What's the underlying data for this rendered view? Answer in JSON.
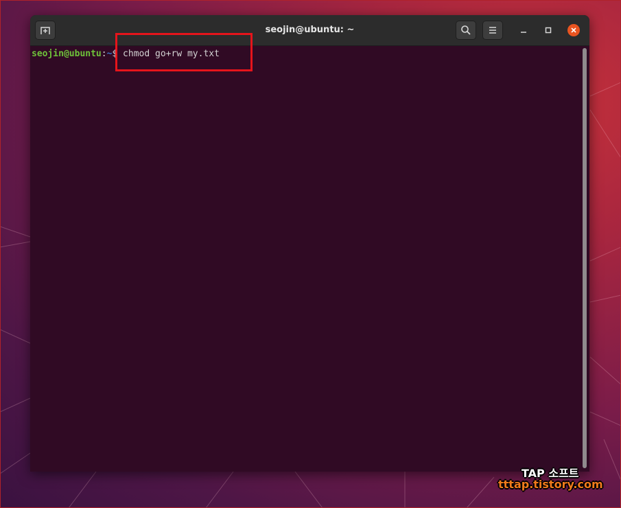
{
  "window": {
    "title": "seojin@ubuntu: ~"
  },
  "terminal": {
    "prompt_user": "seojin@ubuntu",
    "prompt_sep": ":",
    "prompt_path": "~",
    "prompt_symbol": "$",
    "command": " chmod go+rw my.txt"
  },
  "watermark": {
    "title": "TAP 소프트",
    "url": "tttap.tistory.com"
  },
  "colors": {
    "terminal_bg": "#300a24",
    "prompt_user": "#6ec23a",
    "prompt_path": "#3b73c8",
    "close_button": "#e95420",
    "highlight_box": "#e5141b"
  },
  "icons": {
    "new_tab": "new-tab-icon",
    "search": "search-icon",
    "menu": "hamburger-menu-icon",
    "minimize": "minimize-icon",
    "maximize": "maximize-icon",
    "close": "close-icon"
  }
}
